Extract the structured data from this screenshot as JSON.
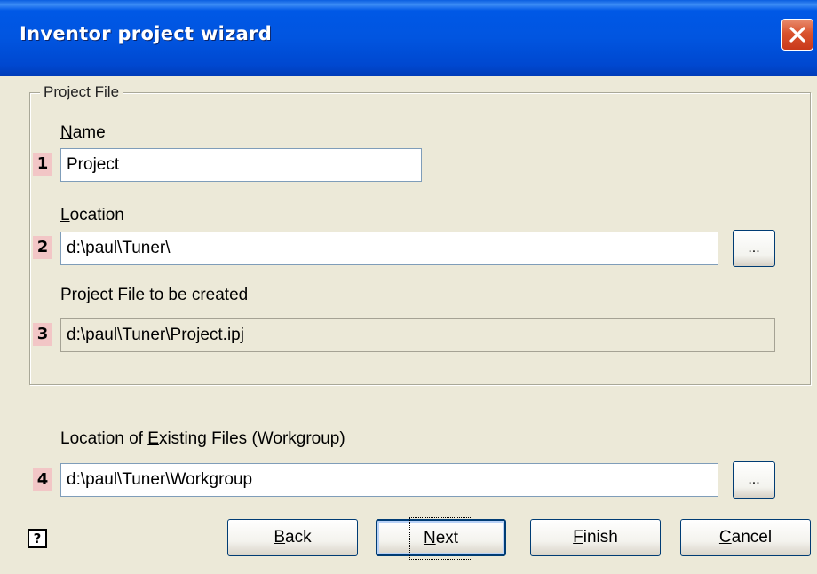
{
  "window": {
    "title": "Inventor project wizard"
  },
  "group": {
    "label": "Project File"
  },
  "name": {
    "step": "1",
    "label_prefix": "",
    "label_key": "N",
    "label_rest": "ame",
    "value": "Project"
  },
  "location": {
    "step": "2",
    "label_key": "L",
    "label_rest": "ocation",
    "value": "d:\\paul\\Tuner\\",
    "browse": "..."
  },
  "project_file": {
    "step": "3",
    "label": "Project File to be created",
    "value": "d:\\paul\\Tuner\\Project.ipj"
  },
  "workgroup": {
    "step": "4",
    "label_prefix": "Location of ",
    "label_key": "E",
    "label_rest": "xisting Files (Workgroup)",
    "value": "d:\\paul\\Tuner\\Workgroup",
    "browse": "..."
  },
  "buttons": {
    "help": "?",
    "back_key": "B",
    "back_rest": "ack",
    "next_key": "N",
    "next_rest": "ext",
    "finish_key": "F",
    "finish_rest": "inish",
    "cancel_key": "C",
    "cancel_rest": "ancel"
  },
  "colors": {
    "titlebar": "#0058e6",
    "close": "#d9532e",
    "step_badge": "#f2c6c6",
    "dialog_bg": "#ece9d8"
  }
}
